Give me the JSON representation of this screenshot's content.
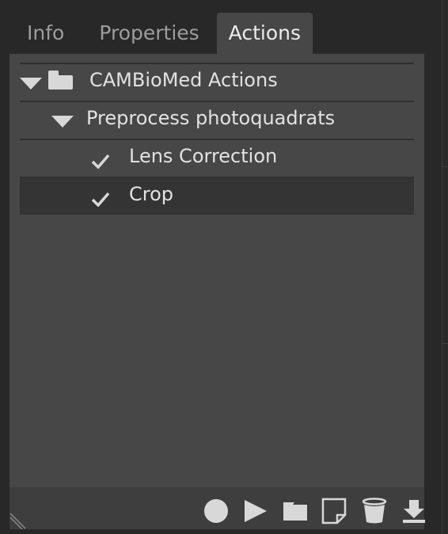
{
  "tabs": [
    {
      "label": "Info",
      "active": false
    },
    {
      "label": "Properties",
      "active": false
    },
    {
      "label": "Actions",
      "active": true
    }
  ],
  "actions": {
    "set": {
      "name": "CAMBioMed Actions",
      "expanded": true
    },
    "action": {
      "name": "Preprocess photoquadrats",
      "expanded": true
    },
    "steps": [
      {
        "name": "Lens Correction",
        "enabled": true,
        "selected": false
      },
      {
        "name": "Crop",
        "enabled": true,
        "selected": true
      }
    ]
  },
  "toolbar": {
    "buttons": [
      "record-icon",
      "play-icon",
      "folder-icon",
      "new-action-icon",
      "trash-icon",
      "download-icon"
    ]
  },
  "colors": {
    "panel": "#474747",
    "selected_row": "#343434",
    "footer": "#3e3e3e",
    "text": "#e2e2e2"
  }
}
